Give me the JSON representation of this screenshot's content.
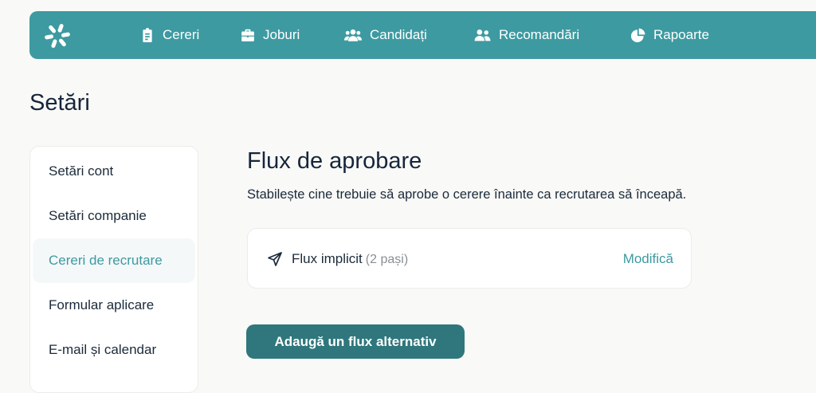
{
  "nav": {
    "items": [
      {
        "label": "Cereri",
        "icon": "clipboard-icon"
      },
      {
        "label": "Joburi",
        "icon": "briefcase-icon"
      },
      {
        "label": "Candidați",
        "icon": "users-icon"
      },
      {
        "label": "Recomandări",
        "icon": "user-friends-icon"
      },
      {
        "label": "Rapoarte",
        "icon": "pie-chart-icon"
      }
    ]
  },
  "page": {
    "title": "Setări"
  },
  "sidebar": {
    "items": [
      {
        "label": "Setări cont"
      },
      {
        "label": "Setări companie"
      },
      {
        "label": "Cereri de recrutare",
        "active": true
      },
      {
        "label": "Formular aplicare"
      },
      {
        "label": "E-mail și calendar"
      }
    ]
  },
  "section": {
    "title": "Flux de aprobare",
    "description": "Stabilește cine trebuie să aprobe o cerere înainte ca recrutarea să înceapă."
  },
  "flow": {
    "name": "Flux implicit",
    "steps": "(2 pași)",
    "edit_label": "Modifică",
    "icon": "paper-plane-icon"
  },
  "actions": {
    "add_flow_label": "Adaugă un flux alternativ"
  },
  "colors": {
    "brand": "#3d9aa1",
    "button": "#2f777c",
    "background": "#f9f9f7",
    "text": "#1b2a3a"
  }
}
